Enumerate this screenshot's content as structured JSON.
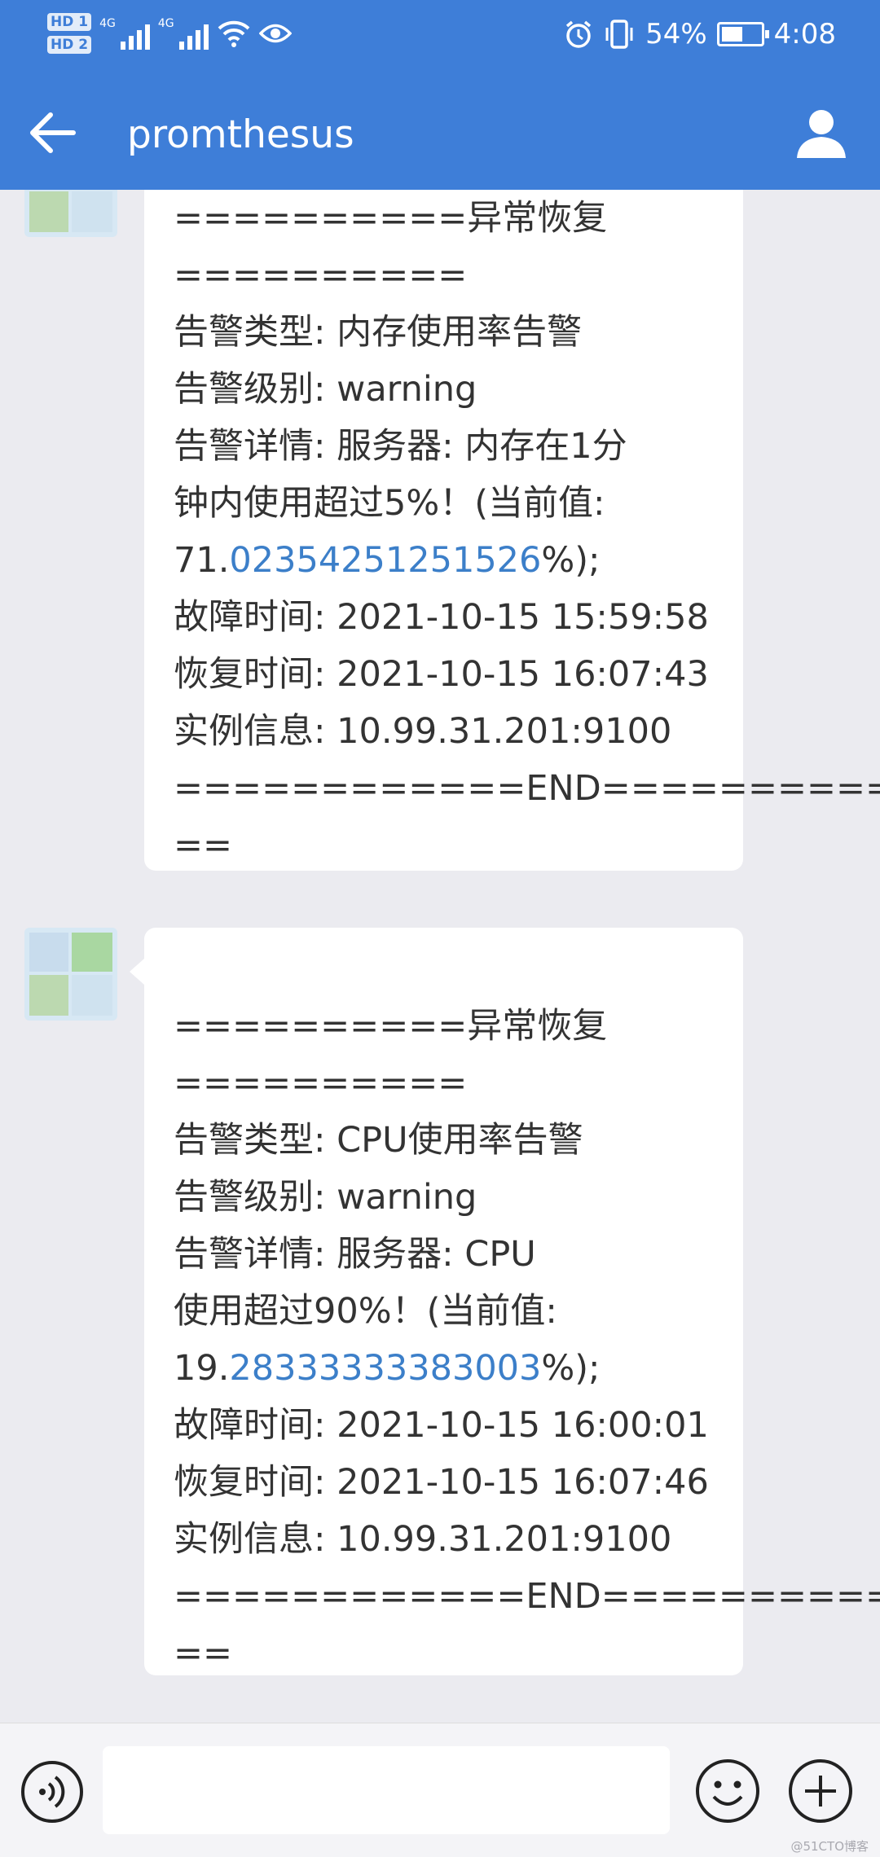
{
  "status_bar": {
    "hd1": "HD",
    "hd1_sub": "1",
    "hd2": "HD",
    "hd2_sub": "2",
    "net1": "4G",
    "net2": "4G",
    "battery_percent": "54%",
    "battery_level": 0.54,
    "time": "4:08"
  },
  "header": {
    "title": "promthesus"
  },
  "messages": [
    {
      "lines": [
        {
          "text": "==========异常恢复"
        },
        {
          "text": "=========="
        },
        {
          "text": "告警类型: 内存使用率告警"
        },
        {
          "text": "告警级别: warning"
        },
        {
          "text": "告警详情: 服务器: 内存在1分"
        },
        {
          "text": "钟内使用超过5%！(当前值:"
        },
        {
          "pre": "71.",
          "link": "02354251251526",
          "post": "%);"
        },
        {
          "text": "故障时间: 2021-10-15 15:59:58"
        },
        {
          "text": "恢复时间: 2021-10-15 16:07:43"
        },
        {
          "text": "实例信息: 10.99.31.201:9100"
        },
        {
          "text": "============END=========="
        },
        {
          "text": "=="
        }
      ]
    },
    {
      "lines": [
        {
          "text": "==========异常恢复"
        },
        {
          "text": "=========="
        },
        {
          "text": "告警类型: CPU使用率告警"
        },
        {
          "text": "告警级别: warning"
        },
        {
          "text": "告警详情: 服务器: CPU"
        },
        {
          "text": "使用超过90%！(当前值:"
        },
        {
          "pre": "19.",
          "link": "28333333383003",
          "post": "%);"
        },
        {
          "text": "故障时间: 2021-10-15 16:00:01"
        },
        {
          "text": "恢复时间: 2021-10-15 16:07:46"
        },
        {
          "text": "实例信息: 10.99.31.201:9100"
        },
        {
          "text": "============END=========="
        },
        {
          "text": "=="
        }
      ]
    }
  ],
  "input_bar": {
    "value": ""
  },
  "watermark": "@51CTO博客",
  "colors": {
    "accent": "#3e7ed8",
    "link": "#3c7fc9",
    "background": "#ebebf0",
    "bubble": "#ffffff"
  },
  "icons": [
    "back-arrow-icon",
    "person-icon",
    "voice-icon",
    "emoji-icon",
    "plus-icon",
    "alarm-icon",
    "vibrate-icon",
    "wifi-icon",
    "eye-icon",
    "battery-icon",
    "signal-icon"
  ]
}
